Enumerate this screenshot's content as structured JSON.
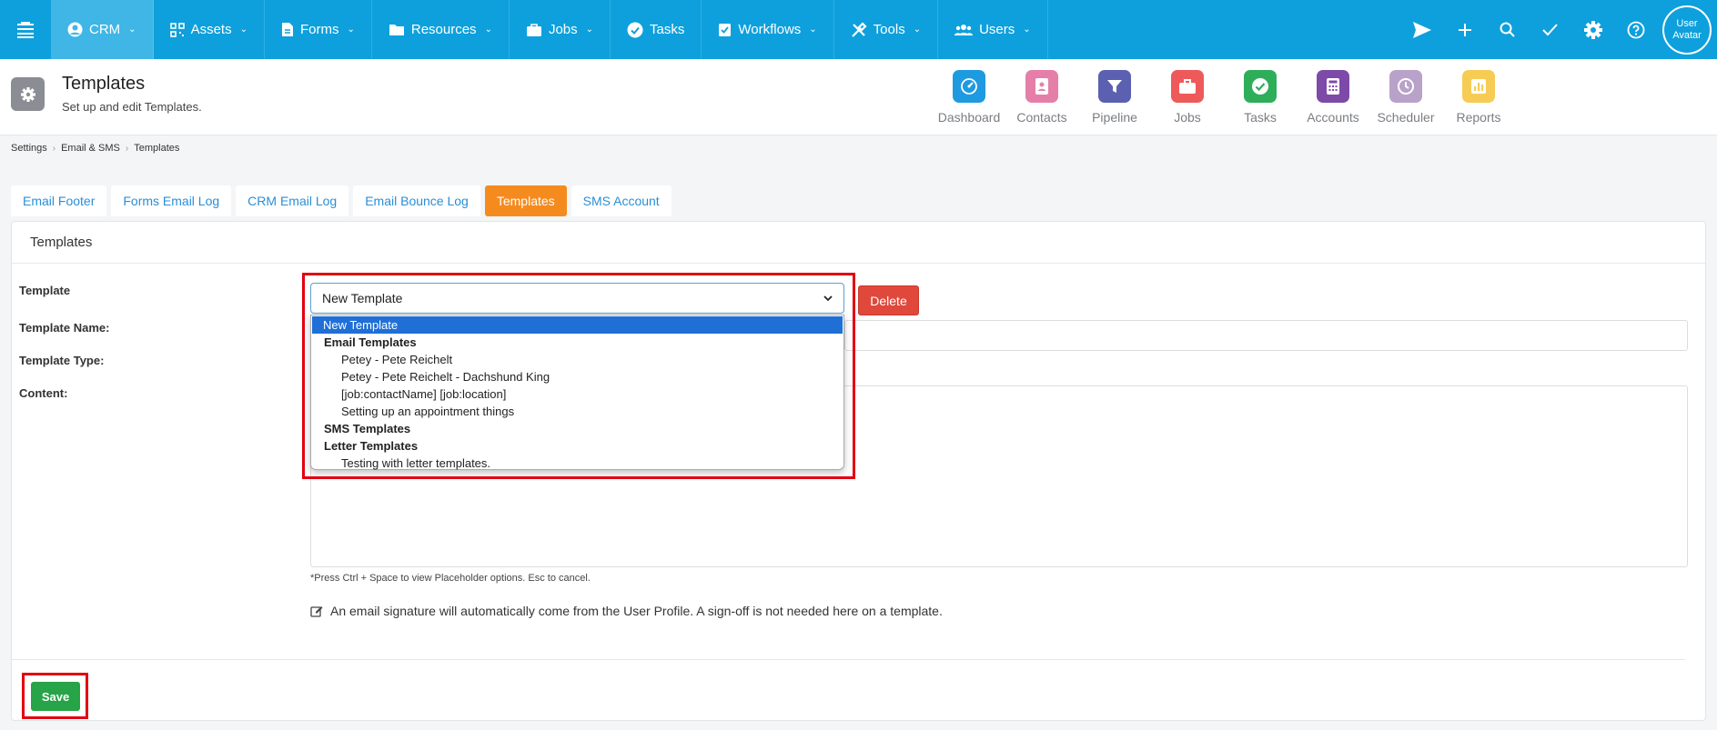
{
  "nav": {
    "items": [
      {
        "label": "CRM",
        "icon": "user-circle-icon",
        "chevron": true,
        "active": true
      },
      {
        "label": "Assets",
        "icon": "qr-code-icon",
        "chevron": true
      },
      {
        "label": "Forms",
        "icon": "document-icon",
        "chevron": true
      },
      {
        "label": "Resources",
        "icon": "folder-icon",
        "chevron": true
      },
      {
        "label": "Jobs",
        "icon": "briefcase-icon",
        "chevron": true
      },
      {
        "label": "Tasks",
        "icon": "check-circle-icon",
        "chevron": false
      },
      {
        "label": "Workflows",
        "icon": "clipboard-check-icon",
        "chevron": true
      },
      {
        "label": "Tools",
        "icon": "tools-icon",
        "chevron": true
      },
      {
        "label": "Users",
        "icon": "users-icon",
        "chevron": true
      }
    ],
    "chevron": "⌄",
    "avatar_line1": "User",
    "avatar_line2": "Avatar"
  },
  "header": {
    "title": "Templates",
    "subtitle": "Set up and edit Templates."
  },
  "quick_links": [
    {
      "label": "Dashboard",
      "color": "#1e9ae0",
      "icon": "dashboard-icon"
    },
    {
      "label": "Contacts",
      "color": "#e57fa9",
      "icon": "contacts-icon"
    },
    {
      "label": "Pipeline",
      "color": "#5b60b0",
      "icon": "filter-icon"
    },
    {
      "label": "Jobs",
      "color": "#ee5a5a",
      "icon": "briefcase-icon"
    },
    {
      "label": "Tasks",
      "color": "#2fae5a",
      "icon": "check-circle-icon"
    },
    {
      "label": "Accounts",
      "color": "#7e4aa8",
      "icon": "calculator-icon"
    },
    {
      "label": "Scheduler",
      "color": "#b9a2c9",
      "icon": "clock-icon"
    },
    {
      "label": "Reports",
      "color": "#f6cc55",
      "icon": "chart-icon"
    }
  ],
  "breadcrumb": [
    "Settings",
    "Email & SMS",
    "Templates"
  ],
  "breadcrumb_sep": "›",
  "tabs": [
    {
      "label": "Email Footer"
    },
    {
      "label": "Forms Email Log"
    },
    {
      "label": "CRM Email Log"
    },
    {
      "label": "Email Bounce Log"
    },
    {
      "label": "Templates",
      "active": true
    },
    {
      "label": "SMS Account"
    }
  ],
  "panel": {
    "title": "Templates",
    "template_label": "Template",
    "template_name_label": "Template Name:",
    "template_type_label": "Template Type:",
    "content_label": "Content:",
    "selected_template": "New Template",
    "delete_label": "Delete",
    "hint": "*Press Ctrl + Space to view Placeholder options. Esc to cancel.",
    "signature_note": "An email signature will automatically come from the User Profile. A sign-off is not needed here on a template.",
    "save_label": "Save"
  },
  "dropdown": {
    "options": [
      {
        "label": "New Template",
        "kind": "selected"
      },
      {
        "label": "Email Templates",
        "kind": "group"
      },
      {
        "label": "Petey - Pete Reichelt",
        "kind": "child"
      },
      {
        "label": "Petey - Pete Reichelt - Dachshund King",
        "kind": "child"
      },
      {
        "label": "[job:contactName] [job:location]",
        "kind": "child"
      },
      {
        "label": "Setting up an appointment things",
        "kind": "child"
      },
      {
        "label": "SMS Templates",
        "kind": "group"
      },
      {
        "label": "Letter Templates",
        "kind": "group"
      },
      {
        "label": "Testing with letter templates.",
        "kind": "child"
      }
    ]
  }
}
